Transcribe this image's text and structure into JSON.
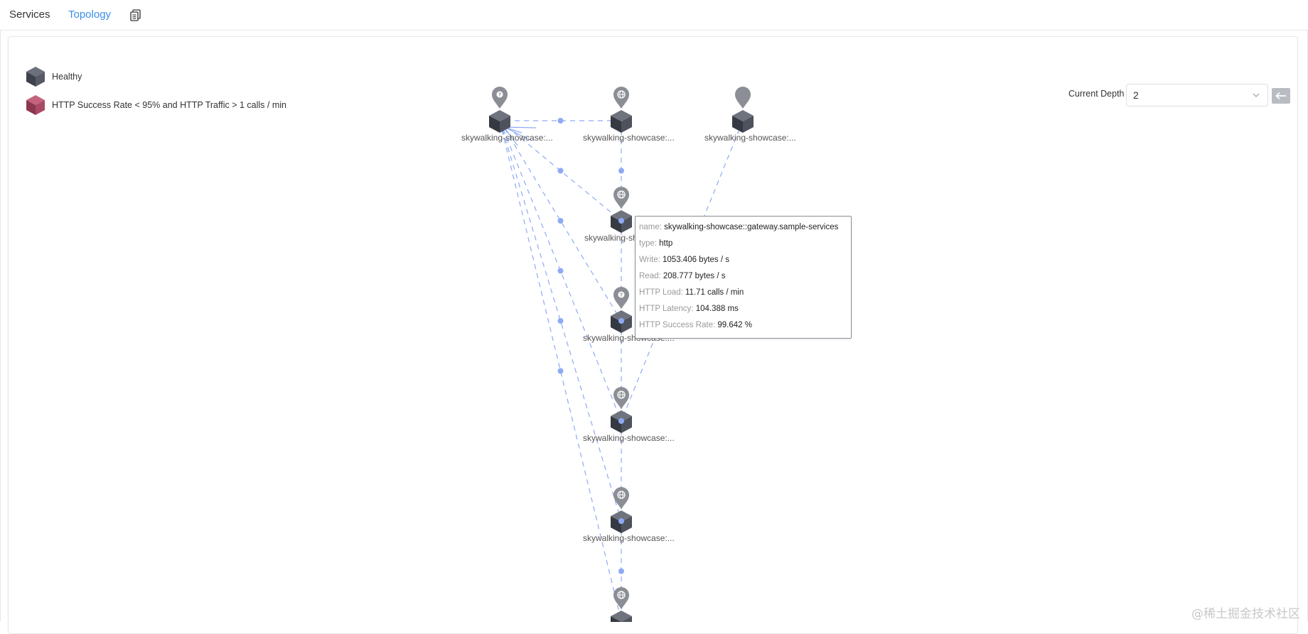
{
  "tabs": {
    "services": "Services",
    "topology": "Topology"
  },
  "icons": {
    "doc": "document-copy-icon",
    "back": "arrow-left-icon",
    "chevron": "chevron-down-icon",
    "healthy": "cube-dark",
    "unhealthy": "cube-red"
  },
  "colors": {
    "accent": "#3a8ee6",
    "healthy": "#4a4f5b",
    "unhealthy": "#b04a66",
    "edge": "#8eaaf5",
    "pin": "#8b8e94"
  },
  "legend": {
    "healthy": "Healthy",
    "unhealthy": "HTTP Success Rate < 95% and HTTP Traffic > 1 calls / min"
  },
  "depth": {
    "label": "Current Depth",
    "value": "2"
  },
  "nodes": [
    {
      "label": "skywalking-showcase:..."
    },
    {
      "label": "skywalking-showcase:..."
    },
    {
      "label": "skywalking-showcase:..."
    },
    {
      "label": "skywalking-sh"
    },
    {
      "label": "skywalking-showcase:..."
    },
    {
      "label": "skywalking-showcase:..."
    },
    {
      "label": "skywalking-showcase:..."
    },
    {
      "label": ""
    }
  ],
  "tooltip": {
    "rows": [
      {
        "key": "name:",
        "value": "skywalking-showcase::gateway.sample-services"
      },
      {
        "key": "type:",
        "value": "http"
      },
      {
        "key": "Write:",
        "value": "1053.406 bytes / s"
      },
      {
        "key": "Read:",
        "value": "208.777 bytes / s"
      },
      {
        "key": "HTTP Load:",
        "value": "11.71 calls / min"
      },
      {
        "key": "HTTP Latency:",
        "value": "104.388 ms"
      },
      {
        "key": "HTTP Success Rate:",
        "value": "99.642 %"
      }
    ]
  },
  "watermark": "@稀土掘金技术社区"
}
